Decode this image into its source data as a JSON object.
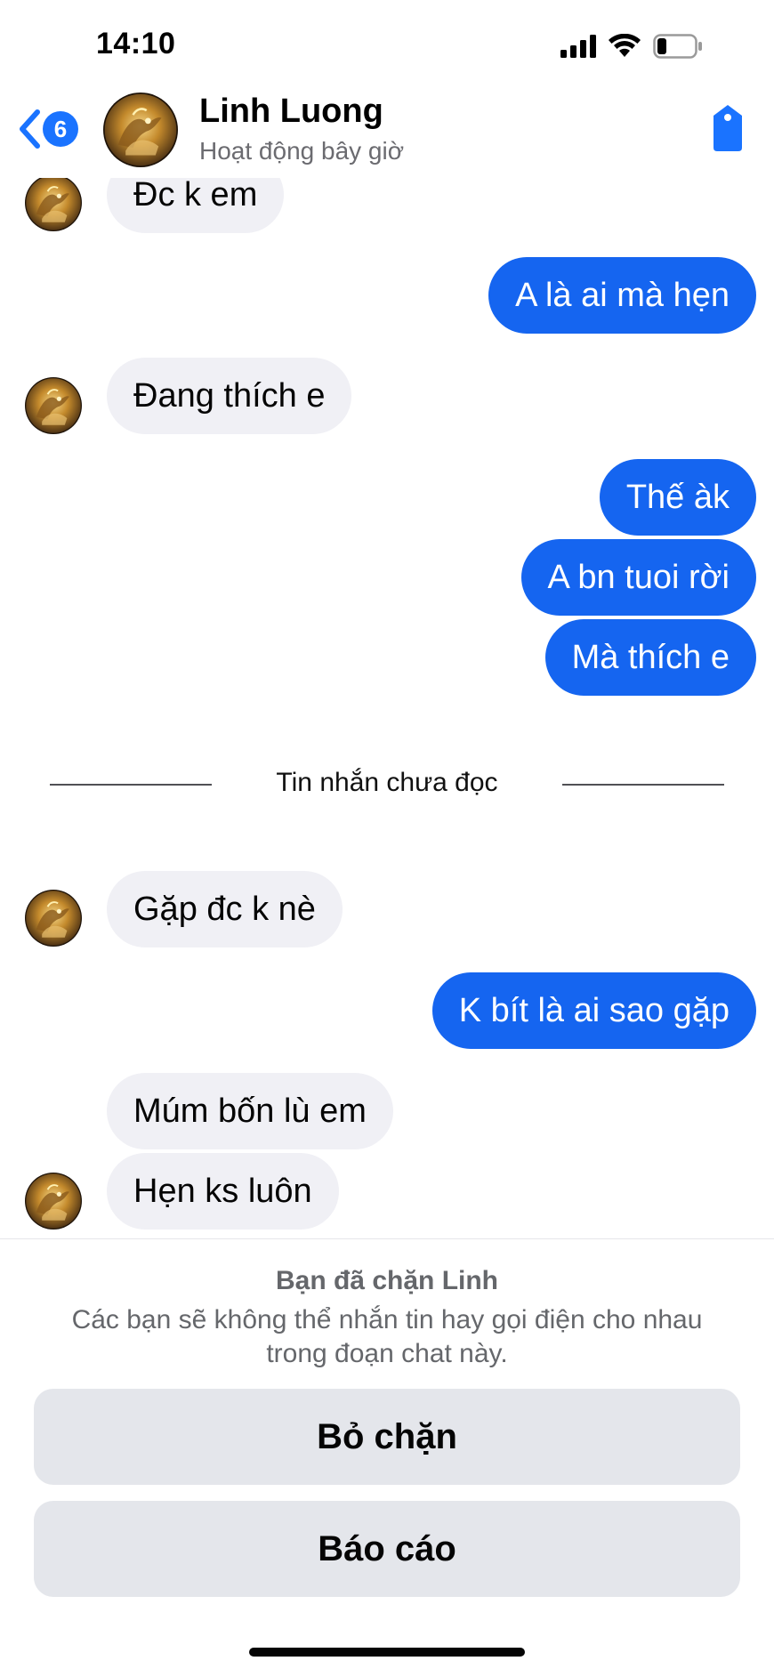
{
  "status_bar": {
    "time": "14:10",
    "battery_level": 0.22
  },
  "header": {
    "back_badge": "6",
    "contact_name": "Linh Luong",
    "activity_status": "Hoạt động bây giờ",
    "icons": {
      "back": "chevron-left-icon",
      "tag": "tag-icon"
    },
    "accent_color": "#1a73ff"
  },
  "messages": [
    {
      "direction": "incoming",
      "text": "Đc k em"
    },
    {
      "direction": "outgoing",
      "text": "A là ai mà hẹn"
    },
    {
      "direction": "incoming",
      "text": "Đang thích e"
    },
    {
      "direction": "outgoing",
      "text": "Thế àk"
    },
    {
      "direction": "outgoing",
      "text": "A bn tuoi rời"
    },
    {
      "direction": "outgoing",
      "text": "Mà thích e"
    },
    {
      "direction": "incoming",
      "text": "Gặp đc k nè"
    },
    {
      "direction": "outgoing",
      "text": "K bít là ai sao gặp"
    },
    {
      "direction": "incoming",
      "text": "Múm bốn lù em"
    },
    {
      "direction": "incoming",
      "text": "Hẹn ks luôn"
    }
  ],
  "unread_divider": "Tin nhắn chưa đọc",
  "blocked_panel": {
    "title": "Bạn đã chặn Linh",
    "description": "Các bạn sẽ không thể nhắn tin hay gọi điện cho nhau trong đoạn chat này.",
    "unblock_label": "Bỏ chặn",
    "report_label": "Báo cáo"
  },
  "colors": {
    "outgoing_bubble": "#1565f0",
    "incoming_bubble": "#f0f0f5"
  }
}
